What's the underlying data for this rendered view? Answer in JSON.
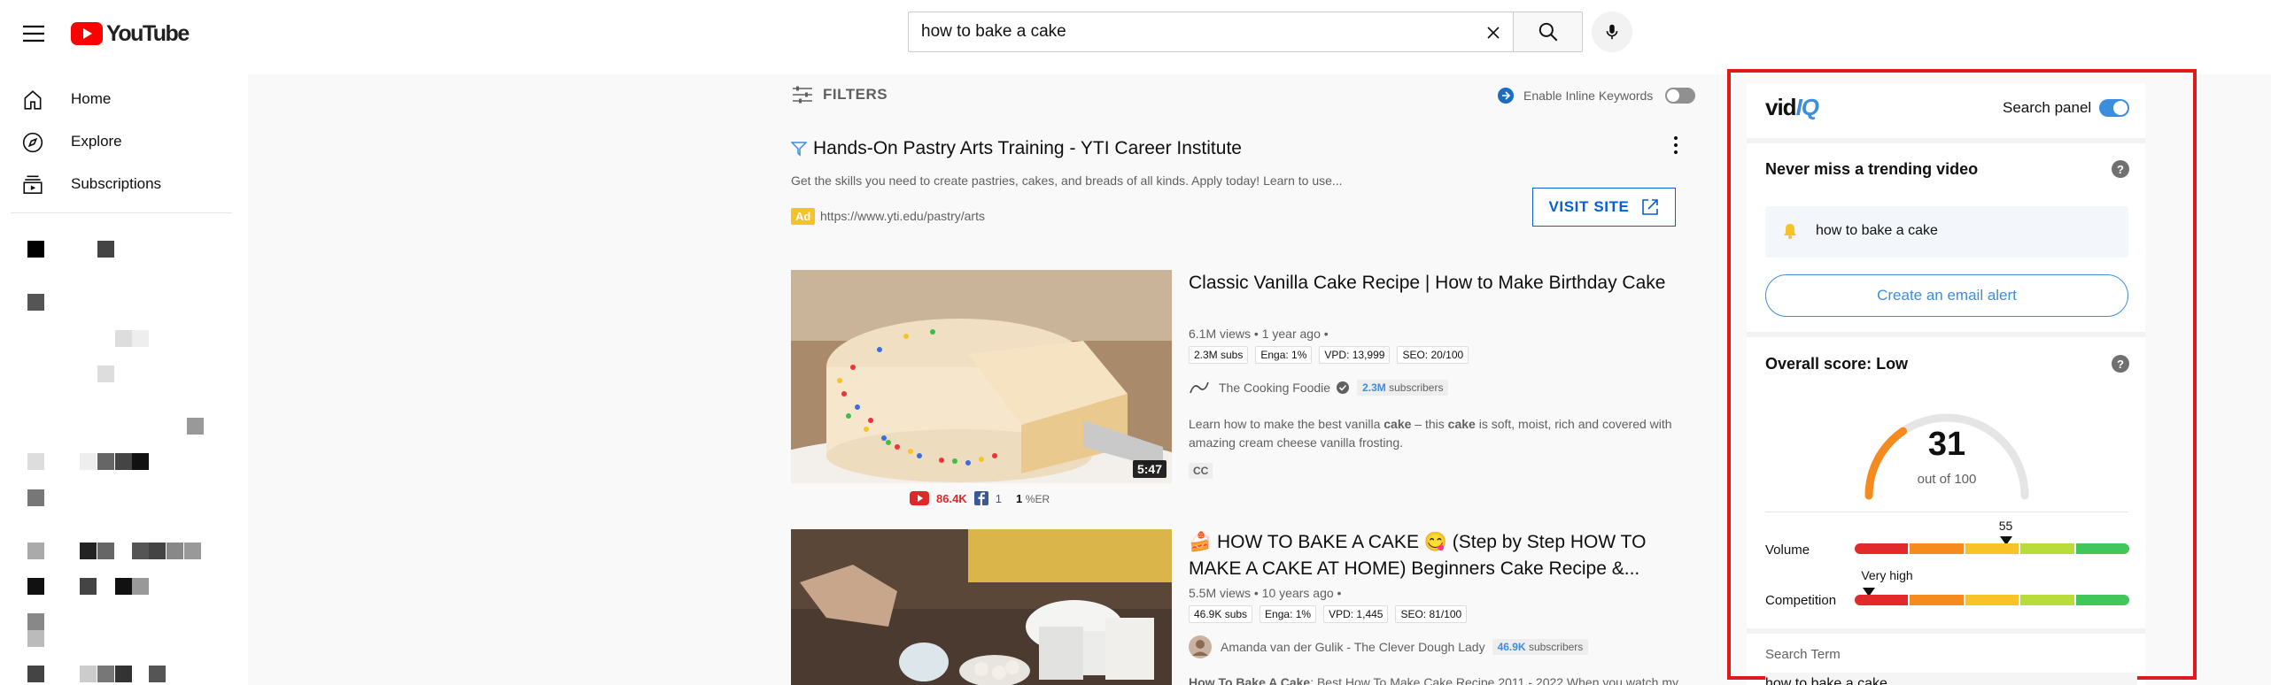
{
  "header": {
    "logo_text": "YouTube",
    "search": {
      "value": "how to bake a cake"
    }
  },
  "sidebar": {
    "items": [
      {
        "label": "Home",
        "icon": "home-icon"
      },
      {
        "label": "Explore",
        "icon": "compass-icon"
      },
      {
        "label": "Subscriptions",
        "icon": "subscriptions-icon"
      }
    ]
  },
  "results": {
    "filters_label": "FILTERS",
    "inline_keywords_label": "Enable Inline Keywords",
    "ad": {
      "title": "Hands-On Pastry Arts Training - YTI Career Institute",
      "description": "Get the skills you need to create pastries, cakes, and breads of all kinds. Apply today! Learn to use...",
      "badge": "Ad",
      "url": "https://www.yti.edu/pastry/arts",
      "cta": "VISIT SITE"
    },
    "videos": [
      {
        "title": "Classic Vanilla Cake Recipe | How to Make Birthday Cake",
        "meta": "6.1M views • 1 year ago •",
        "tags": [
          "2.3M subs",
          "Enga: 1%",
          "VPD: 13,999",
          "SEO: 20/100"
        ],
        "channel": "The Cooking Foodie",
        "channel_subs_count": "2.3M",
        "channel_subs_word": "subscribers",
        "desc_parts": [
          "Learn how to make the best vanilla ",
          "cake",
          " – this ",
          "cake",
          " is soft, moist, rich and covered with amazing cream cheese vanilla frosting."
        ],
        "badge": "CC",
        "duration": "5:47",
        "yt_stat": "86.4K",
        "fb_stat": "1",
        "er_value": "1",
        "er_label": "%ER"
      },
      {
        "title": "🍰 HOW TO BAKE A CAKE 😋 (Step by Step HOW TO MAKE A CAKE AT HOME) Beginners Cake Recipe &...",
        "meta": "5.5M views • 10 years ago •",
        "tags": [
          "46.9K subs",
          "Enga: 1%",
          "VPD: 1,445",
          "SEO: 81/100"
        ],
        "channel": "Amanda van der Gulik - The Clever Dough Lady",
        "channel_subs_count": "46.9K",
        "channel_subs_word": "subscribers",
        "desc_parts": [
          "How To Bake A Cake",
          ": Best How To Make Cake Recipe 2011 - 2022 When you watch my"
        ]
      }
    ]
  },
  "vidiq": {
    "logo_main": "vid",
    "logo_accent": "IQ",
    "search_panel_label": "Search panel",
    "trending": {
      "title": "Never miss a trending video",
      "keyword": "how to bake a cake",
      "button": "Create an email alert"
    },
    "score": {
      "title": "Overall score: Low",
      "value": "31",
      "max_label": "out of 100",
      "fraction": 0.31
    },
    "volume": {
      "label": "Volume",
      "value": "55",
      "fraction": 0.55
    },
    "competition": {
      "label": "Competition",
      "value": "Very high",
      "fraction": 0.05
    },
    "search_term_label": "Search Term",
    "search_term_value": "how to bake a cake",
    "colors": {
      "accent": "#3c8dde",
      "frame": "#e0191a",
      "bar": [
        "#e32a2a",
        "#f58a1f",
        "#f7c327",
        "#b8dc3a",
        "#42c55a"
      ]
    }
  }
}
